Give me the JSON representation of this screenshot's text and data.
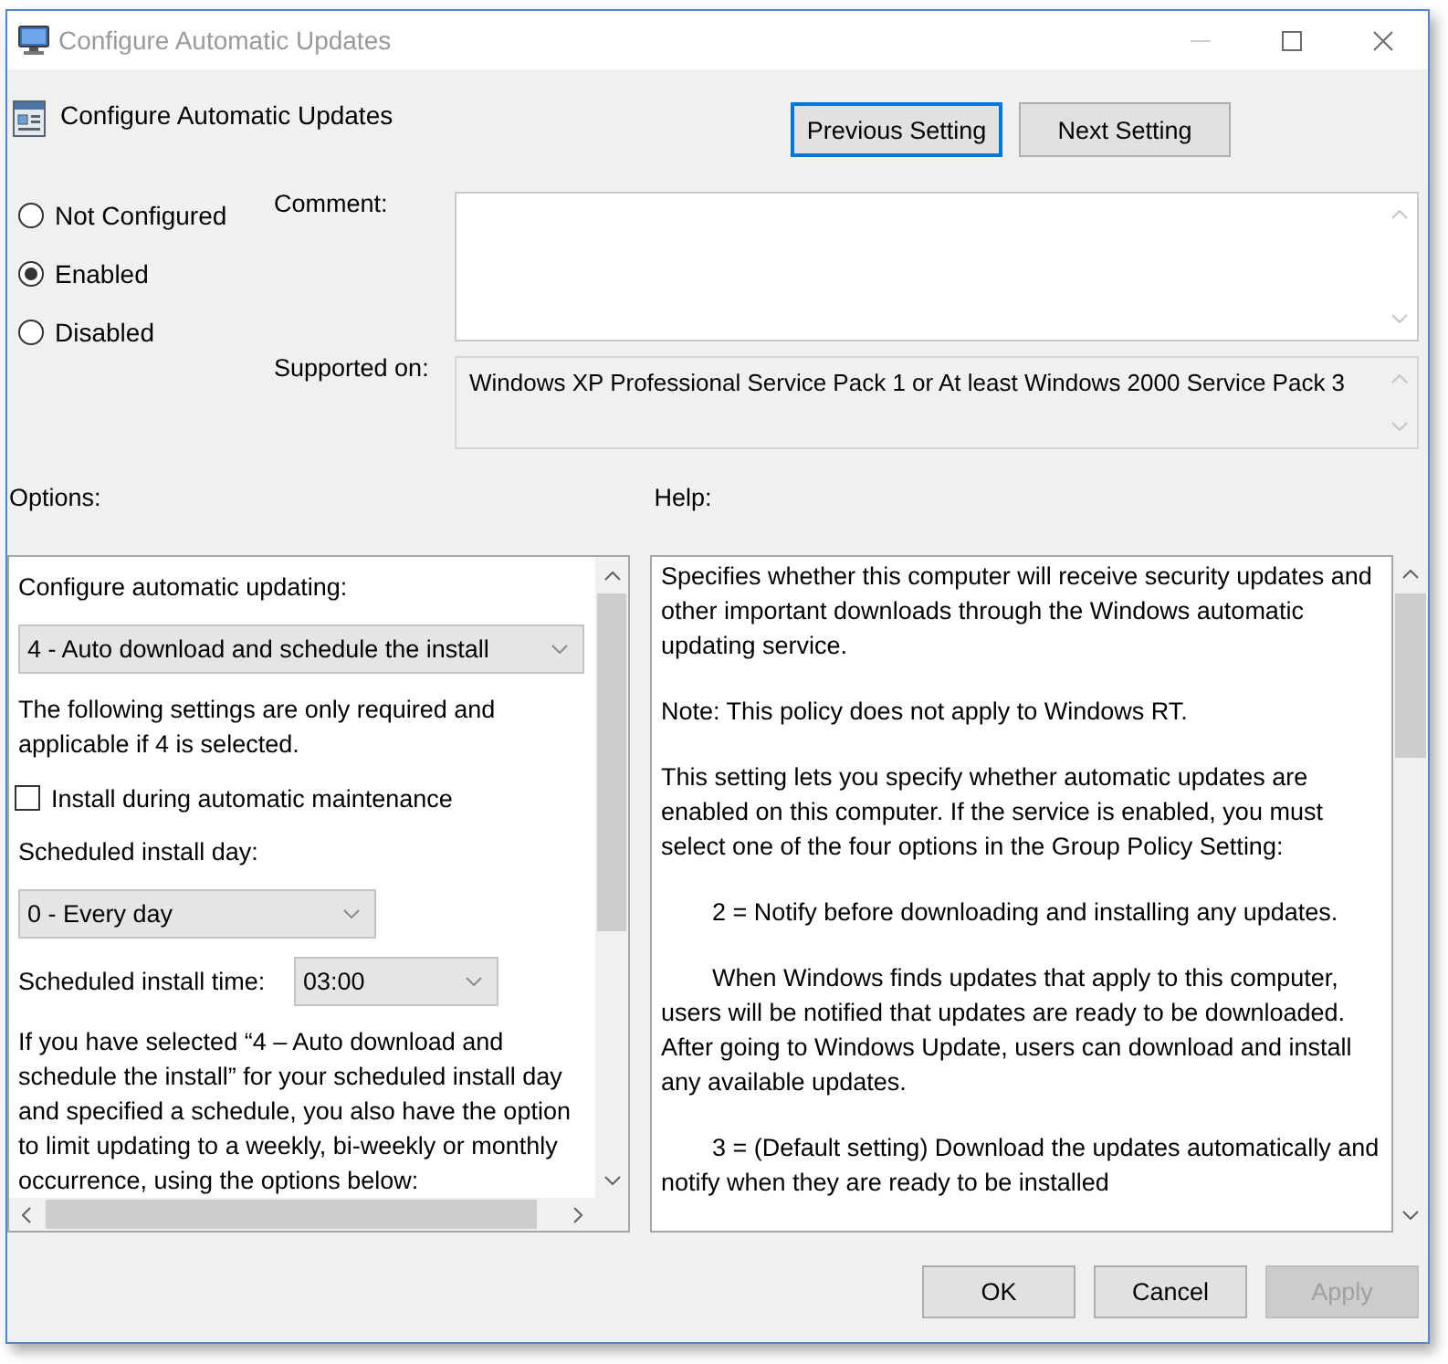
{
  "window": {
    "title": "Configure Automatic Updates"
  },
  "header": {
    "title": "Configure Automatic Updates",
    "nav_buttons": [
      {
        "label": "Previous Setting",
        "focused": true
      },
      {
        "label": "Next Setting",
        "focused": false
      }
    ]
  },
  "state_options": [
    {
      "label": "Not Configured",
      "selected": false
    },
    {
      "label": "Enabled",
      "selected": true
    },
    {
      "label": "Disabled",
      "selected": false
    }
  ],
  "comment": {
    "label": "Comment:"
  },
  "supported_on": {
    "label": "Supported on:",
    "value": "Windows XP Professional Service Pack 1 or At least Windows 2000 Service Pack 3"
  },
  "options": {
    "label": "Options:",
    "items": [
      {
        "kind": "label",
        "text": "Configure automatic updating:"
      },
      {
        "kind": "dropdown",
        "value": "4 - Auto download and schedule the install",
        "wide": true
      },
      {
        "kind": "text",
        "text": "The following settings are only required and applicable if 4 is selected."
      },
      {
        "kind": "checkbox",
        "label": "Install during automatic maintenance",
        "checked": false
      },
      {
        "kind": "label",
        "text": "Scheduled install day:"
      },
      {
        "kind": "dropdown",
        "value": "0 - Every day",
        "wide": false
      },
      {
        "kind": "inline",
        "label": "Scheduled install time:",
        "value": "03:00"
      },
      {
        "kind": "text",
        "text": "If you have selected “4 – Auto download and schedule the install” for your scheduled install day and specified a schedule, you also have the option to limit updating to a weekly, bi-weekly or monthly occurrence, using the options below:"
      }
    ]
  },
  "help": {
    "label": "Help:",
    "paragraphs": [
      {
        "kind": "plain",
        "text": "Specifies whether this computer will receive security updates and other important downloads through the Windows automatic updating service."
      },
      {
        "kind": "plain",
        "text": "Note: This policy does not apply to Windows RT."
      },
      {
        "kind": "plain",
        "text": "This setting lets you specify whether automatic updates are enabled on this computer. If the service is enabled, you must select one of the four options in the Group Policy Setting:"
      },
      {
        "kind": "indented",
        "text": "2 = Notify before downloading and installing any updates."
      },
      {
        "kind": "indented",
        "text": "When Windows finds updates that apply to this computer, users will be notified that updates are ready to be downloaded. After going to Windows Update, users can download and install any available updates."
      },
      {
        "kind": "indented",
        "text": "3 = (Default setting) Download the updates automatically and notify when they are ready to be installed"
      }
    ]
  },
  "buttons": [
    {
      "label": "OK",
      "disabled": false
    },
    {
      "label": "Cancel",
      "disabled": false
    },
    {
      "label": "Apply",
      "disabled": true
    }
  ]
}
